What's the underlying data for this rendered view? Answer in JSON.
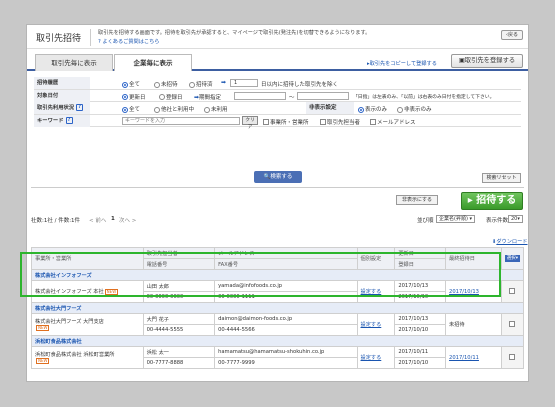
{
  "header": {
    "title": "取引先招待",
    "description": "取引先を招待する画面です。招待を取引先が承認すると、マイページで取引先(発注先)を切替できるようになります。",
    "faq_link": "よくあるご質問はこちら",
    "back_label": "戻る"
  },
  "tabs": [
    {
      "label": "取引先毎に表示"
    },
    {
      "label": "企業毎に表示"
    }
  ],
  "links": {
    "copy": "取引先をコピーして登録する"
  },
  "register_button": "取引先を登録する",
  "filters": {
    "history": {
      "label": "招待履歴",
      "options": [
        "全て",
        "未招待",
        "招待済"
      ],
      "days_value": "1",
      "days_text": "日以内に招待した取引先を除く"
    },
    "target_date": {
      "label": "対象日付",
      "options": [
        "更新日",
        "登録日"
      ],
      "period_label": "期間指定",
      "tilde": "〜",
      "note": "「日指」は左表のみ、「以前」は右表のみ日付を指定して下さい。"
    },
    "usage": {
      "label": "取引先利用状況",
      "options": [
        "全て",
        "他社と利用中",
        "未利用"
      ],
      "display_label": "非表示設定",
      "display_options": [
        "表示のみ",
        "非表示のみ"
      ]
    },
    "keyword": {
      "label": "キーワード",
      "placeholder": "キーワードを入力",
      "clear": "クリア",
      "checks": [
        "事業所・営業所",
        "取引先担当者",
        "メールアドレス"
      ]
    },
    "search_button": "検索する",
    "reset_button": "検索リセット"
  },
  "actions": {
    "hide_button": "非表示にする",
    "invite_button": "招待する"
  },
  "toolbar": {
    "summary": "社数:1社 / 件数:1件",
    "prev": "< 前へ",
    "page": "1",
    "next": "次へ >",
    "sort_label": "並び順",
    "sort_value": "企業名(昇順)",
    "per_page_label": "表示件数",
    "per_page_value": "20"
  },
  "download_link": "ダウンロード",
  "table": {
    "headers": {
      "office": "事業所・営業所",
      "contact": "取引先担当者",
      "phone": "電話番号",
      "email": "メールアドレス",
      "fax": "FAX番号",
      "personal": "個別設定",
      "updated": "更新日",
      "registered": "登録日",
      "last_invite": "最終招待日",
      "select": "選択"
    },
    "groups": [
      {
        "company": "株式会社インフォフーズ",
        "office": "株式会社インフォフーズ 本社",
        "new": "NEW",
        "contact": "山田 太郎",
        "phone": "00-0000-0000",
        "email": "yamada@infofoods.co.jp",
        "fax": "00-0000-1111",
        "setting": "設定する",
        "updated": "2017/10/13",
        "registered": "2017/10/10",
        "last_invite": "2017/10/13"
      },
      {
        "company": "株式会社大門フーズ",
        "office": "株式会社大門フーズ 大門支店",
        "new": "NEW",
        "contact": "大門 花子",
        "phone": "00-4444-5555",
        "email": "daimon@daimon-foods.co.jp",
        "fax": "00-4444-5566",
        "setting": "設定する",
        "updated": "2017/10/13",
        "registered": "2017/10/10",
        "last_invite": "未招待"
      },
      {
        "company": "浜松町食品株式会社",
        "office": "浜松町食品株式会社 浜松町営業所",
        "new": "NEW",
        "contact": "浜松 太一",
        "phone": "00-7777-8888",
        "email": "hamamatsu@hamamatsu-shokuhin.co.jp",
        "fax": "00-7777-9999",
        "setting": "設定する",
        "updated": "2017/10/11",
        "registered": "2017/10/10",
        "last_invite": "2017/10/11"
      }
    ]
  },
  "colors": {
    "accent": "#3d5ea1",
    "invite": "#3a9a2a",
    "highlight": "#2db52d",
    "link": "#1a55b0"
  }
}
